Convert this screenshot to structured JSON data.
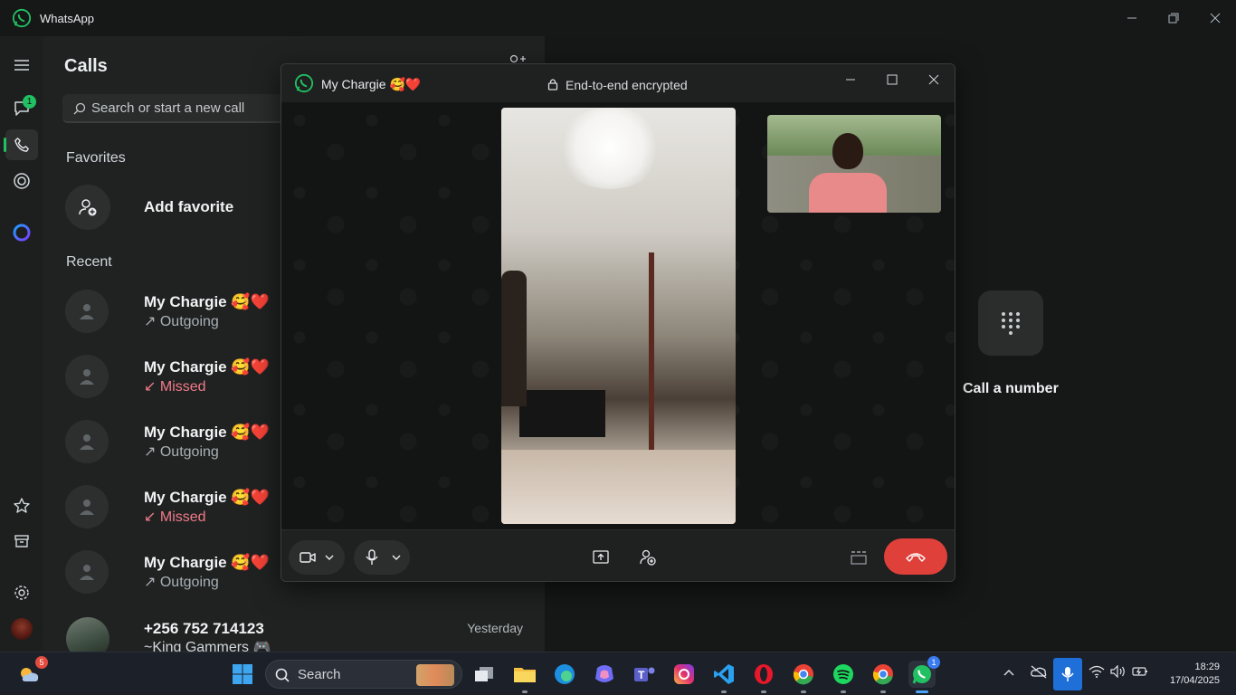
{
  "app": {
    "title": "WhatsApp"
  },
  "rail": {
    "chats_badge": "1"
  },
  "calls": {
    "title": "Calls",
    "search_placeholder": "Search or start a new call",
    "favorites_label": "Favorites",
    "add_favorite": "Add favorite",
    "recent_label": "Recent",
    "recent": [
      {
        "name": "My Chargie 🥰❤️",
        "status": "Outgoing",
        "missed": false
      },
      {
        "name": "My Chargie 🥰❤️",
        "status": "Missed",
        "missed": true
      },
      {
        "name": "My Chargie 🥰❤️",
        "status": "Outgoing",
        "missed": false
      },
      {
        "name": "My Chargie 🥰❤️",
        "status": "Missed",
        "missed": true
      },
      {
        "name": "My Chargie 🥰❤️",
        "status": "Outgoing",
        "missed": false
      }
    ],
    "last_row": {
      "name": "+256 752 714123",
      "sub": "~King Gammers 🎮",
      "date": "Yesterday"
    }
  },
  "right": {
    "call_number_label": "Call a number"
  },
  "call_window": {
    "contact": "My Chargie 🥰❤️",
    "encryption": "End-to-end encrypted"
  },
  "taskbar": {
    "weather_badge": "5",
    "search_label": "Search",
    "whatsapp_badge": "1",
    "time": "18:29",
    "date": "17/04/2025"
  },
  "colors": {
    "accent": "#21c063",
    "missed": "#f07a88",
    "end_call": "#e0403a"
  }
}
